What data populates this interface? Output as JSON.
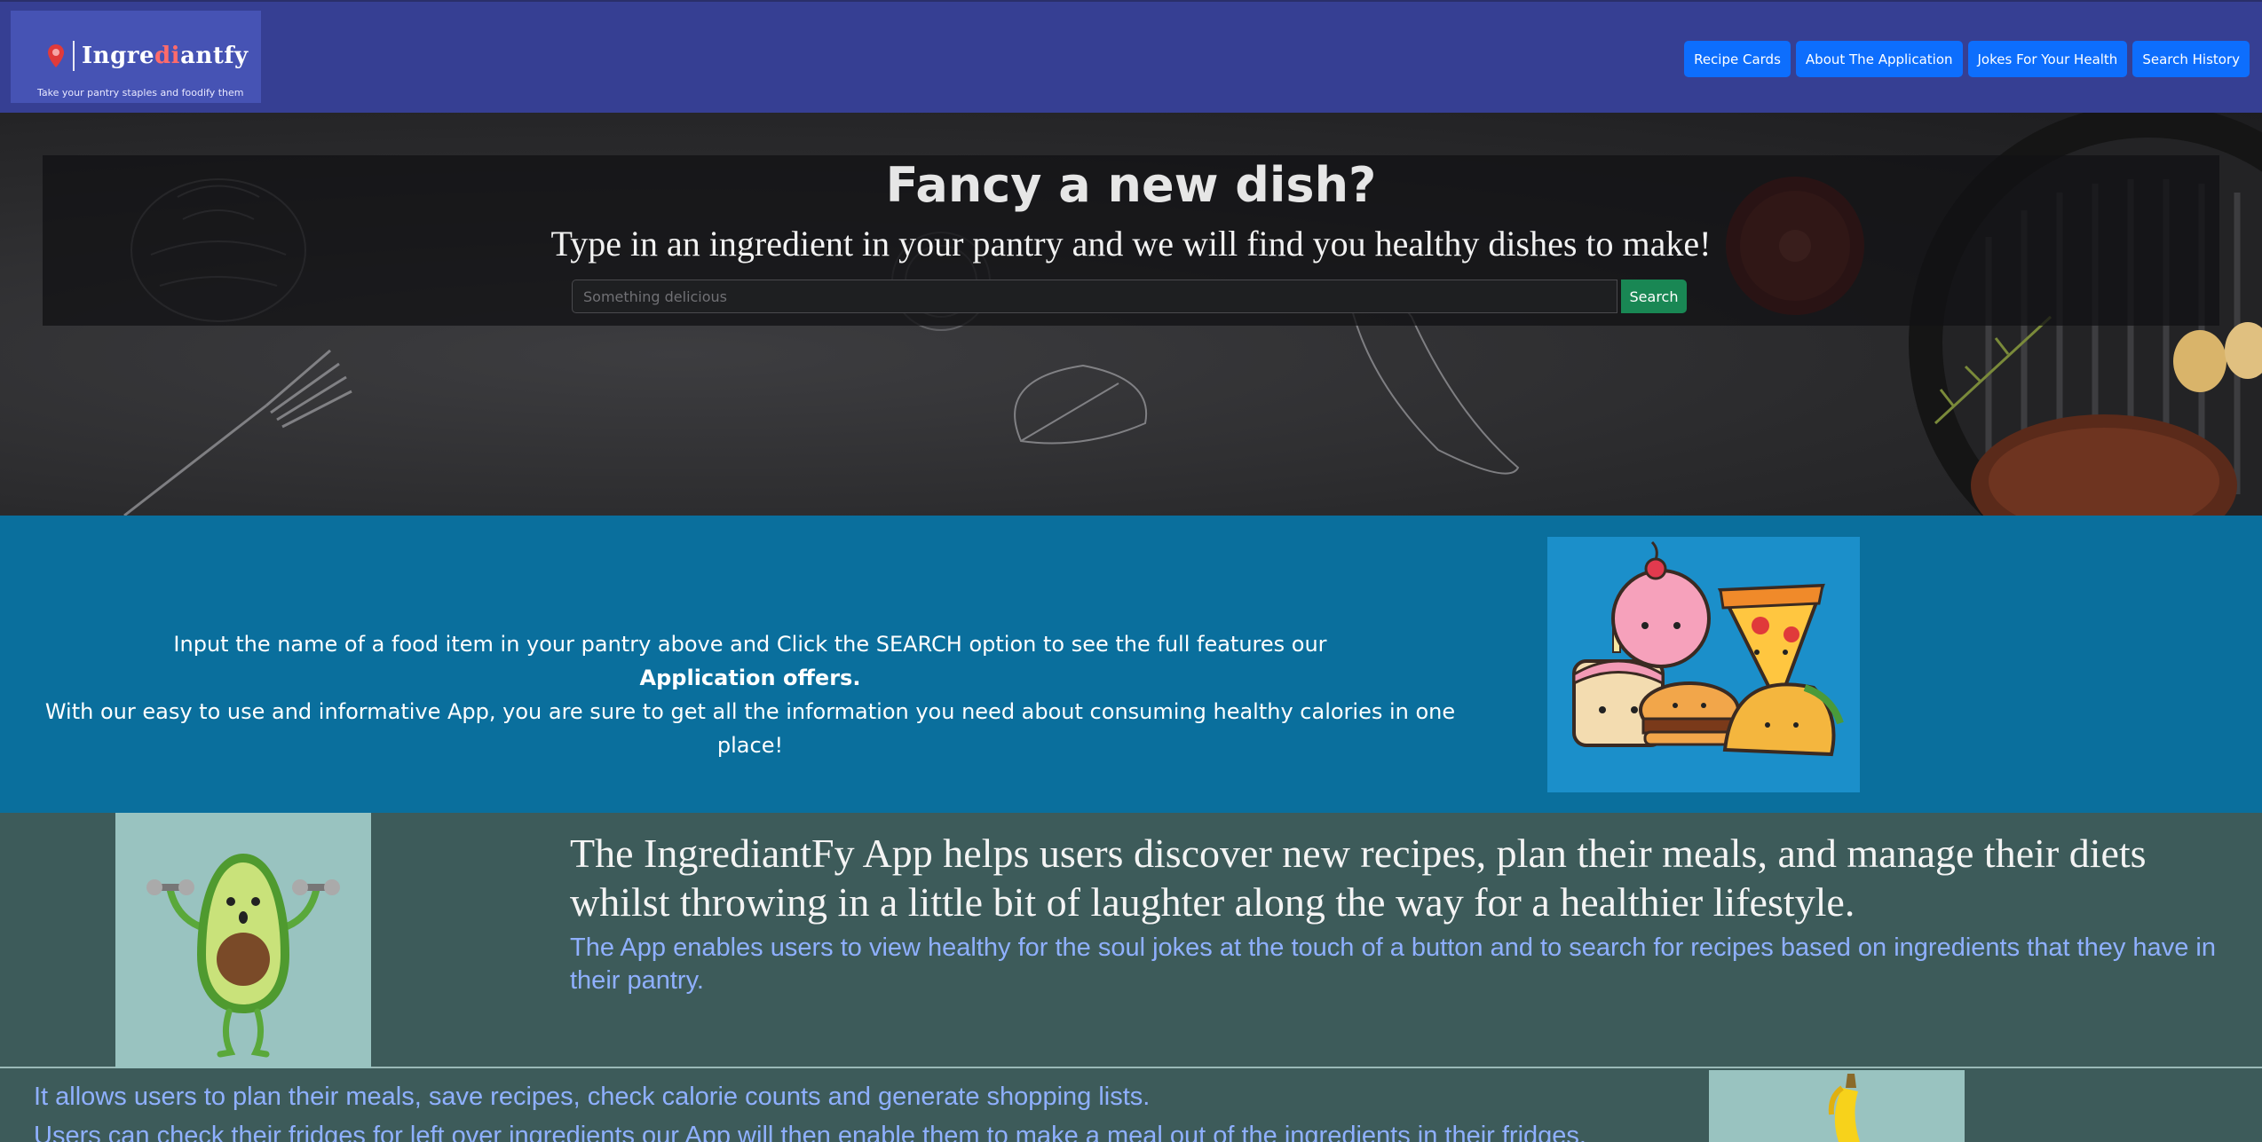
{
  "brand": {
    "title_pre": "Ingre",
    "title_accent": "di",
    "title_post": "antfy",
    "tagline": "Take your pantry staples and foodify them"
  },
  "nav": {
    "items": [
      {
        "label": "Recipe Cards"
      },
      {
        "label": "About The Application"
      },
      {
        "label": "Jokes For Your Health"
      },
      {
        "label": "Search History"
      }
    ]
  },
  "hero": {
    "title": "Fancy a new dish?",
    "subtitle": "Type in an ingredient in your pantry and we will find you healthy dishes to make!",
    "search_placeholder": "Something delicious",
    "search_label": "Search"
  },
  "features": {
    "line1": "Input the name of a food item in your pantry above and Click the SEARCH option to see the full features our",
    "line2": "Application offers.",
    "line3": "With our easy to use and informative App, you are sure to get all the information you need about consuming healthy calories in one place!"
  },
  "about": {
    "heading": "The IngrediantFy App helps users discover new recipes, plan their meals, and manage their diets whilst throwing in a little bit of laughter along the way for a healthier lifestyle.",
    "subtext": "The App enables users to view healthy for the soul jokes at the touch of a button and to search for recipes based on ingredients that they have in their pantry."
  },
  "more": {
    "line1": "It allows users to plan their meals, save recipes, check calorie counts and generate shopping lists.",
    "line2": "Users can check their fridges for left over ingredients our App will then enable them to make a meal out of the ingredients in their fridges."
  },
  "colors": {
    "header": "#363f93",
    "nav_button": "#0d6efd",
    "search_button": "#198754",
    "blue_section": "#0a6f9d",
    "green_section": "#3d5b5a",
    "link_text": "#8fb0ff"
  }
}
